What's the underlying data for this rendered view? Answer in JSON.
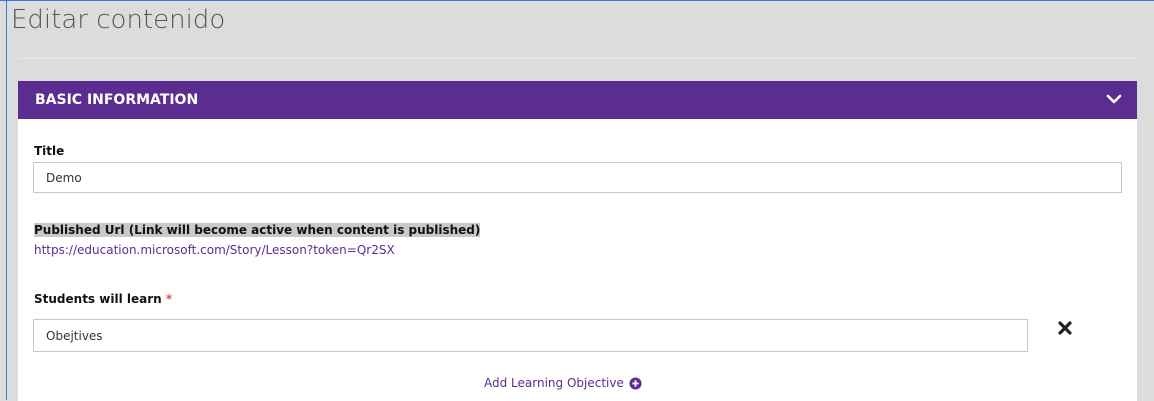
{
  "page": {
    "title": "Editar contenido"
  },
  "panel": {
    "header": "BASIC INFORMATION",
    "chevron_icon": "chevron-down-icon"
  },
  "fields": {
    "title_label": "Title",
    "title_value": "Demo",
    "published_url_label": "Published Url (Link will become active when content is published)",
    "published_url": "https://education.microsoft.com/Story/Lesson?token=Qr2SX",
    "objectives_label": "Students will learn",
    "objectives_required_mark": "*",
    "objective_value": "Obejtives",
    "remove_icon": "close-icon",
    "add_objective_label": "Add Learning Objective",
    "add_objective_icon": "plus-circle-icon"
  },
  "colors": {
    "accent": "#5c2d91",
    "required": "#d9534f",
    "background": "#dcdcdc"
  }
}
